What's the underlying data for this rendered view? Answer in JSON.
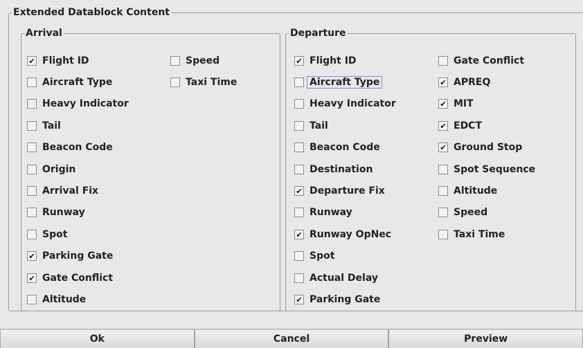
{
  "dialog": {
    "title": "Extended Datablock Content"
  },
  "arrival": {
    "title": "Arrival",
    "col1": [
      {
        "label": "Flight ID",
        "checked": true
      },
      {
        "label": "Aircraft Type",
        "checked": false
      },
      {
        "label": "Heavy Indicator",
        "checked": false
      },
      {
        "label": "Tail",
        "checked": false
      },
      {
        "label": "Beacon Code",
        "checked": false
      },
      {
        "label": "Origin",
        "checked": false
      },
      {
        "label": "Arrival Fix",
        "checked": false
      },
      {
        "label": "Runway",
        "checked": false
      },
      {
        "label": "Spot",
        "checked": false
      },
      {
        "label": "Parking Gate",
        "checked": true
      },
      {
        "label": "Gate Conflict",
        "checked": true
      },
      {
        "label": "Altitude",
        "checked": false
      }
    ],
    "col2": [
      {
        "label": "Speed",
        "checked": false
      },
      {
        "label": "Taxi Time",
        "checked": false
      }
    ]
  },
  "departure": {
    "title": "Departure",
    "col1": [
      {
        "label": "Flight ID",
        "checked": true
      },
      {
        "label": "Aircraft Type",
        "checked": false,
        "focused": true
      },
      {
        "label": "Heavy Indicator",
        "checked": false
      },
      {
        "label": "Tail",
        "checked": false
      },
      {
        "label": "Beacon Code",
        "checked": false
      },
      {
        "label": "Destination",
        "checked": false
      },
      {
        "label": "Departure Fix",
        "checked": true
      },
      {
        "label": "Runway",
        "checked": false
      },
      {
        "label": "Runway OpNec",
        "checked": true
      },
      {
        "label": "Spot",
        "checked": false
      },
      {
        "label": "Actual Delay",
        "checked": false
      },
      {
        "label": "Parking Gate",
        "checked": true
      }
    ],
    "col2": [
      {
        "label": "Gate Conflict",
        "checked": false
      },
      {
        "label": "APREQ",
        "checked": true
      },
      {
        "label": "MIT",
        "checked": true
      },
      {
        "label": "EDCT",
        "checked": true
      },
      {
        "label": "Ground Stop",
        "checked": true
      },
      {
        "label": "Spot Sequence",
        "checked": false
      },
      {
        "label": "Altitude",
        "checked": false
      },
      {
        "label": "Speed",
        "checked": false
      },
      {
        "label": "Taxi Time",
        "checked": false
      }
    ]
  },
  "buttons": {
    "ok": "Ok",
    "cancel": "Cancel",
    "preview": "Preview"
  }
}
